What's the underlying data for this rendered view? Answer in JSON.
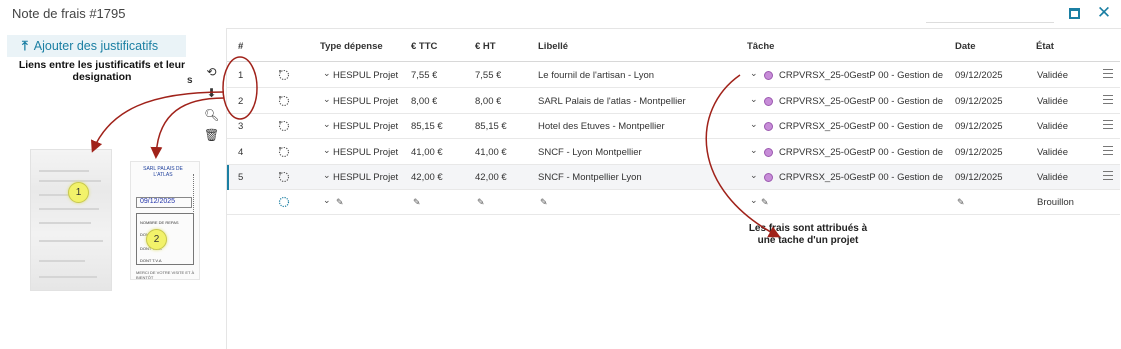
{
  "window": {
    "title": "Note de frais #1795"
  },
  "left_panel": {
    "add_button": "Ajouter des justificatifs",
    "annotation": "Liens entre les justificatifs et leur designation",
    "annotation_cut": "s",
    "doc1_badge": "1",
    "doc2_badge": "2",
    "doc2_header": "SARL PALAIS DE L'ATLAS",
    "doc2_date": "09/12/2025",
    "doc2_foot": "MERCI DE VOTRE VISITE ET À BIENTÔT"
  },
  "table": {
    "headers": {
      "num": "#",
      "type": "Type dépense",
      "ttc": "€ TTC",
      "ht": "€ HT",
      "libelle": "Libellé",
      "tache": "Tâche",
      "date": "Date",
      "etat": "État"
    },
    "rows": [
      {
        "num": "1",
        "type": "HESPUL Projet",
        "ttc": "7,55 €",
        "ht": "7,55 €",
        "libelle": "Le fournil de l'artisan - Lyon",
        "tache": "CRPVRSX_25-0GestP 00 - Gestion de",
        "date": "09/12/2025",
        "etat": "Validée"
      },
      {
        "num": "2",
        "type": "HESPUL Projet",
        "ttc": "8,00 €",
        "ht": "8,00 €",
        "libelle": "SARL Palais de l'atlas - Montpellier",
        "tache": "CRPVRSX_25-0GestP 00 - Gestion de",
        "date": "09/12/2025",
        "etat": "Validée"
      },
      {
        "num": "3",
        "type": "HESPUL Projet",
        "ttc": "85,15 €",
        "ht": "85,15 €",
        "libelle": "Hotel des Etuves - Montpellier",
        "tache": "CRPVRSX_25-0GestP 00 - Gestion de",
        "date": "09/12/2025",
        "etat": "Validée"
      },
      {
        "num": "4",
        "type": "HESPUL Projet",
        "ttc": "41,00 €",
        "ht": "41,00 €",
        "libelle": "SNCF - Lyon Montpellier",
        "tache": "CRPVRSX_25-0GestP 00 - Gestion de",
        "date": "09/12/2025",
        "etat": "Validée"
      },
      {
        "num": "5",
        "type": "HESPUL Projet",
        "ttc": "42,00 €",
        "ht": "42,00 €",
        "libelle": "SNCF - Montpellier Lyon",
        "tache": "CRPVRSX_25-0GestP 00 - Gestion de",
        "date": "09/12/2025",
        "etat": "Validée"
      }
    ],
    "draft_row": {
      "etat": "Brouillon"
    }
  },
  "annotation_right": "Les frais sont attribués à une tache d'un projet",
  "colors": {
    "accent": "#1b7fa3",
    "arrow": "#a0221a",
    "tag": "#c78cd8"
  }
}
